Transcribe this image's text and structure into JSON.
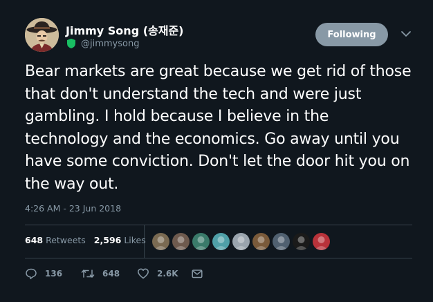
{
  "author": {
    "name": "Jimmy Song (송재준)",
    "handle": "@jimmysong",
    "avatar_icon": "cowboy-avatar",
    "badge_icon": "shield-icon"
  },
  "follow_button": {
    "label": "Following"
  },
  "menu_icon": "chevron-down-icon",
  "tweet": {
    "text": "Bear markets are great because we get rid of those that don't understand the tech and were just gambling. I hold because I believe in the technology and the economics. Go away until you have some conviction. Don't let the door hit you on the way out.",
    "timestamp": "4:26 AM - 23 Jun 2018"
  },
  "stats": {
    "retweets_count": "648",
    "retweets_label": "Retweets",
    "likes_count": "2,596",
    "likes_label": "Likes"
  },
  "liker_avatars": [
    {
      "name": "liker-avatar",
      "color": "#7a6a52"
    },
    {
      "name": "liker-avatar",
      "color": "#6e5a4e"
    },
    {
      "name": "liker-avatar",
      "color": "#3a7a6a"
    },
    {
      "name": "liker-avatar",
      "color": "#4fa0a8"
    },
    {
      "name": "liker-avatar",
      "color": "#9aa4ad"
    },
    {
      "name": "liker-avatar",
      "color": "#7a5a3a"
    },
    {
      "name": "liker-avatar",
      "color": "#506070"
    },
    {
      "name": "liker-avatar",
      "color": "#1a1a1a"
    },
    {
      "name": "liker-avatar",
      "color": "#b8323a"
    }
  ],
  "actions": {
    "reply_count": "136",
    "retweet_count": "648",
    "like_count": "2.6K"
  },
  "colors": {
    "background": "#10171e",
    "secondary_text": "#8899a6",
    "divider": "#38444d",
    "badge": "#19bf63"
  }
}
